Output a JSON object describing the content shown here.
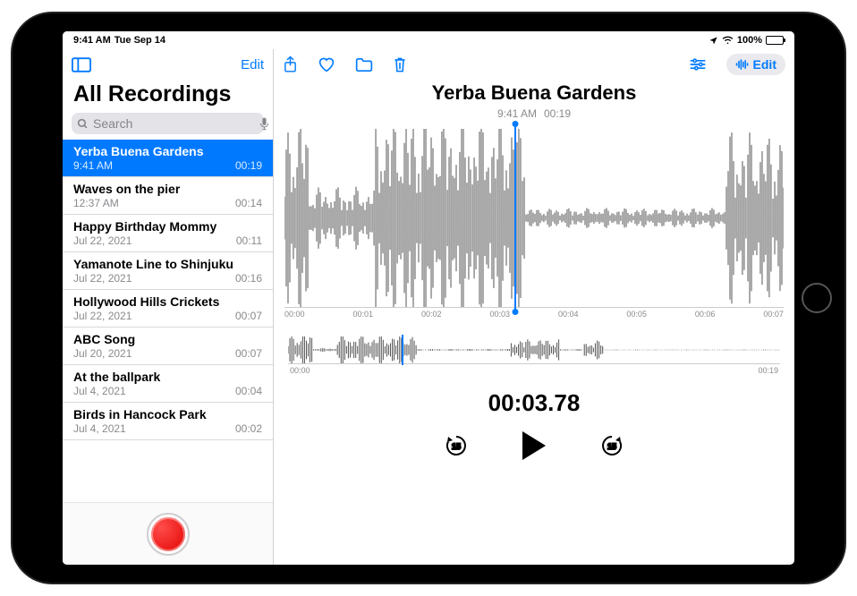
{
  "status": {
    "time": "9:41 AM",
    "date": "Tue Sep 14",
    "battery": "100%"
  },
  "sidebar": {
    "edit_label": "Edit",
    "title": "All Recordings",
    "search_placeholder": "Search",
    "items": [
      {
        "title": "Yerba Buena Gardens",
        "subtitle": "9:41 AM",
        "duration": "00:19",
        "selected": true
      },
      {
        "title": "Waves on the pier",
        "subtitle": "12:37 AM",
        "duration": "00:14"
      },
      {
        "title": "Happy Birthday Mommy",
        "subtitle": "Jul 22, 2021",
        "duration": "00:11"
      },
      {
        "title": "Yamanote Line to Shinjuku",
        "subtitle": "Jul 22, 2021",
        "duration": "00:16"
      },
      {
        "title": "Hollywood Hills Crickets",
        "subtitle": "Jul 22, 2021",
        "duration": "00:07"
      },
      {
        "title": "ABC Song",
        "subtitle": "Jul 20, 2021",
        "duration": "00:07"
      },
      {
        "title": "At the ballpark",
        "subtitle": "Jul 4, 2021",
        "duration": "00:04"
      },
      {
        "title": "Birds in Hancock Park",
        "subtitle": "Jul 4, 2021",
        "duration": "00:02"
      }
    ]
  },
  "main": {
    "toolbar": {
      "edit_label": "Edit"
    },
    "title": "Yerba Buena Gardens",
    "time": "9:41 AM",
    "duration": "00:19",
    "ticks": [
      "00:00",
      "00:01",
      "00:02",
      "00:03",
      "00:04",
      "00:05",
      "00:06",
      "00:07"
    ],
    "small_ticks": {
      "start": "00:00",
      "end": "00:19"
    },
    "counter": "00:03.78",
    "skip_label": "15"
  },
  "colors": {
    "accent": "#007aff"
  }
}
